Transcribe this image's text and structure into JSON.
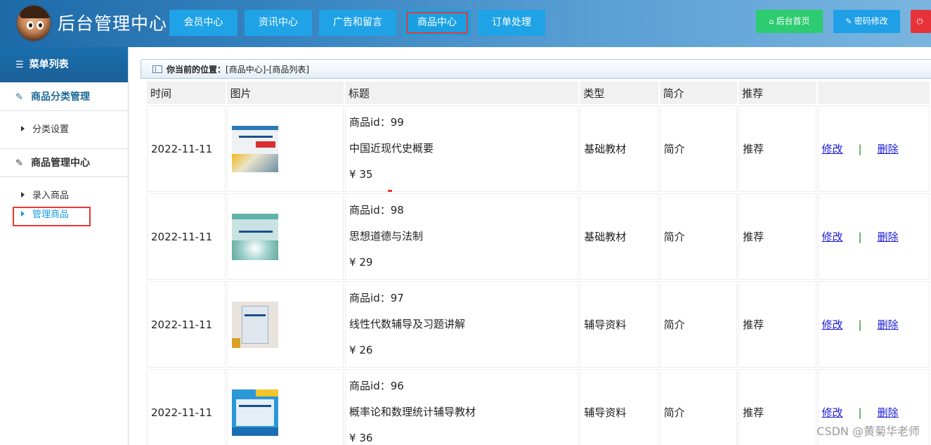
{
  "header": {
    "title": "后台管理中心",
    "nav": [
      "会员中心",
      "资讯中心",
      "广告和留言",
      "商品中心",
      "订单处理"
    ],
    "active_nav": "商品中心",
    "actions": [
      {
        "label": "后台首页",
        "icon": "home-icon",
        "color": "#2ecc71"
      },
      {
        "label": "密码修改",
        "icon": "wrench-icon",
        "color": "#1e9fe6"
      },
      {
        "label": "",
        "icon": "power-icon",
        "color": "#e8323a"
      }
    ]
  },
  "sidebar": {
    "header": "菜单列表",
    "sections": [
      {
        "title": "商品分类管理",
        "items": [
          "分类设置"
        ]
      },
      {
        "title": "商品管理中心",
        "items": [
          "录入商品",
          "管理商品"
        ]
      }
    ],
    "active_item": "管理商品"
  },
  "location": {
    "label": "你当前的位置：",
    "path": "[商品中心]-[商品列表]"
  },
  "table": {
    "headers": [
      "时间",
      "图片",
      "标题",
      "类型",
      "简介",
      "推荐",
      ""
    ],
    "rows": [
      {
        "time": "2022-11-11",
        "id_line": "商品id：99",
        "name": "中国近现代史概要",
        "price": "¥ 35",
        "type": "基础教材",
        "intro": "简介",
        "recommend": "推荐",
        "edit": "修改",
        "sep": "|",
        "delete": "删除"
      },
      {
        "time": "2022-11-11",
        "id_line": "商品id：98",
        "name": "思想道德与法制",
        "price": "¥ 29",
        "type": "基础教材",
        "intro": "简介",
        "recommend": "推荐",
        "edit": "修改",
        "sep": "|",
        "delete": "删除"
      },
      {
        "time": "2022-11-11",
        "id_line": "商品id：97",
        "name": "线性代数辅导及习题讲解",
        "price": "¥ 26",
        "type": "辅导资料",
        "intro": "简介",
        "recommend": "推荐",
        "edit": "修改",
        "sep": "|",
        "delete": "删除"
      },
      {
        "time": "2022-11-11",
        "id_line": "商品id：96",
        "name": "概率论和数理统计辅导教材",
        "price": "¥ 36",
        "type": "辅导资料",
        "intro": "简介",
        "recommend": "推荐",
        "edit": "修改",
        "sep": "|",
        "delete": "删除"
      }
    ]
  },
  "watermark": "CSDN @黄菊华老师"
}
